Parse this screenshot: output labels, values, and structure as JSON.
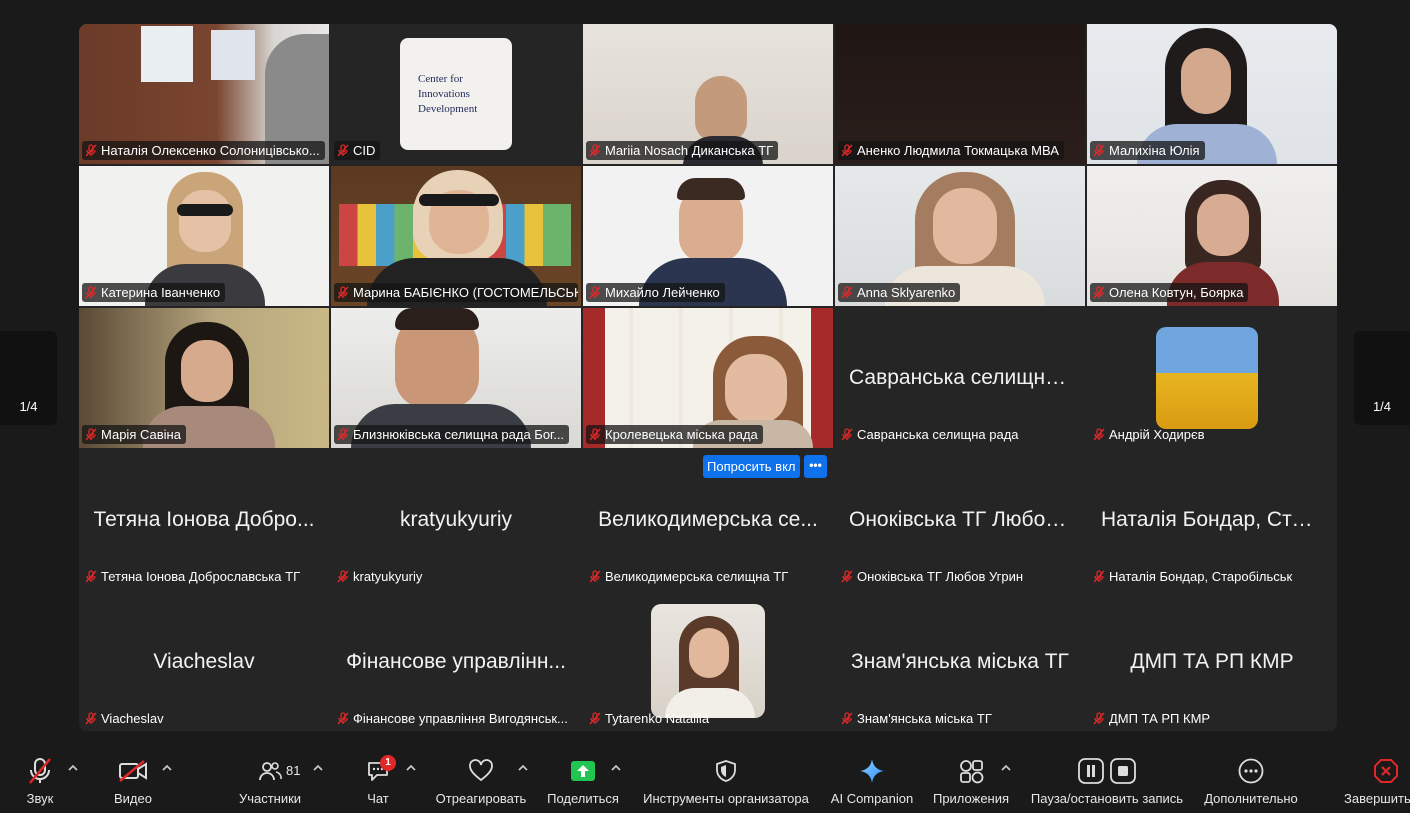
{
  "tiles": [
    {
      "name": "Наталія Олексенко Солоницівсько...",
      "big": ""
    },
    {
      "name": "CID",
      "big": ""
    },
    {
      "name": "Mariia Nosach Диканська ТГ",
      "big": ""
    },
    {
      "name": "Аненко Людмила Токмацька МВА",
      "big": ""
    },
    {
      "name": "Малихіна Юлія",
      "big": ""
    },
    {
      "name": "Катерина Іванченко",
      "big": ""
    },
    {
      "name": "Марина БАБІЄНКО (ГОСТОМЕЛЬСЬК...",
      "big": ""
    },
    {
      "name": "Михайло Лейченко",
      "big": ""
    },
    {
      "name": "Anna Sklyarenko",
      "big": ""
    },
    {
      "name": "Олена Ковтун, Боярка",
      "big": ""
    },
    {
      "name": "Марія Савіна",
      "big": ""
    },
    {
      "name": "Близнюківська селищна рада Бог...",
      "big": ""
    },
    {
      "name": "Кролевецька міська рада",
      "big": ""
    },
    {
      "name": "Савранська селищна рада",
      "big": "Савранська селищна..."
    },
    {
      "name": "Андрій Ходирєв",
      "big": ""
    },
    {
      "name": "Тетяна Іонова Доброславська ТГ",
      "big": "Тетяна Іонова Добро..."
    },
    {
      "name": "kratyukyuriy",
      "big": "kratyukyuriy"
    },
    {
      "name": "Великодимерська селищна ТГ",
      "big": "Великодимерська се..."
    },
    {
      "name": "Оноківська ТГ Любов Угрин",
      "big": "Оноківська ТГ Любов..."
    },
    {
      "name": "Наталія Бондар, Старобільськ",
      "big": "Наталія Бондар, Стар..."
    },
    {
      "name": "Viacheslav",
      "big": "Viacheslav"
    },
    {
      "name": "Фінансове управління Вигодянськ...",
      "big": "Фінансове управлінн..."
    },
    {
      "name": "Tytarenko Nataliia",
      "big": ""
    },
    {
      "name": "Знам'янська міська ТГ",
      "big": "Знам'янська міська ТГ"
    },
    {
      "name": "ДМП ТА РП КМР",
      "big": "ДМП ТА РП КМР"
    }
  ],
  "cid_logo": {
    "line1": "Center for",
    "line2": "Innovations",
    "line3": "Development"
  },
  "request_button": "Попросить вкл",
  "request_more": "•••",
  "pager": {
    "left_label": "1/4",
    "right_label": "1/4"
  },
  "toolbar": {
    "audio": "Звук",
    "video": "Видео",
    "participants": "Участники",
    "participants_count": "81",
    "chat": "Чат",
    "chat_badge": "1",
    "react": "Отреагировать",
    "share": "Поделиться",
    "host_tools": "Инструменты организатора",
    "ai": "AI Companion",
    "apps": "Приложения",
    "record": "Пауза/остановить запись",
    "more": "Дополнительно",
    "end": "Завершить"
  },
  "colors": {
    "accent": "#0e72ed",
    "speaking": "#2ecc40",
    "muted": "#e02828",
    "share": "#23c552"
  }
}
